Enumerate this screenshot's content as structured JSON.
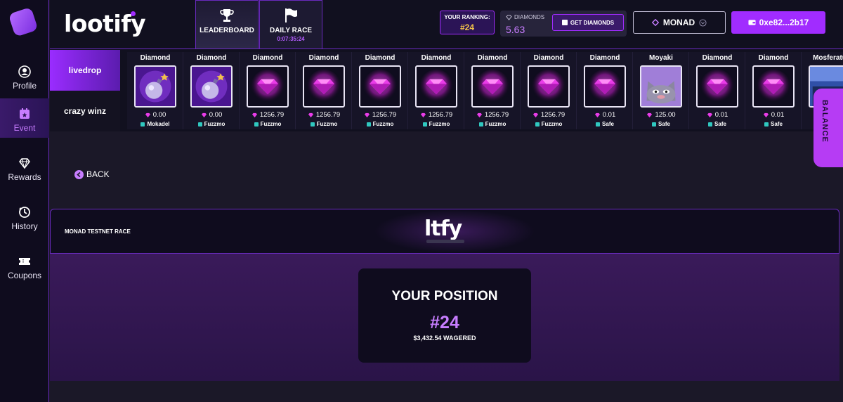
{
  "brand": {
    "name": "lootify"
  },
  "sidebar": {
    "items": [
      {
        "label": "Profile",
        "icon": "profile-icon"
      },
      {
        "label": "Event",
        "icon": "event-icon"
      },
      {
        "label": "Rewards",
        "icon": "diamond-icon"
      },
      {
        "label": "History",
        "icon": "history-icon"
      },
      {
        "label": "Coupons",
        "icon": "coupon-icon"
      }
    ],
    "active": "Event"
  },
  "header": {
    "leaderboard_label": "LEADERBOARD",
    "daily_race_label": "DAILY RACE",
    "daily_race_timer": "0:07:35:24",
    "ranking_label": "YOUR RANKING:",
    "ranking_value": "#24",
    "diamonds_label": "DIAMONDS",
    "diamonds_value": "5.63",
    "get_diamonds_label": "GET DIAMONDS",
    "network_label": "MONAD",
    "wallet_label": "0xe82...2b17"
  },
  "livedrop": {
    "tabs": [
      "livedrop",
      "crazy winz"
    ],
    "items": [
      {
        "name": "Diamond",
        "value": "0.00",
        "user": "Mokadel",
        "art": "bomb"
      },
      {
        "name": "Diamond",
        "value": "0.00",
        "user": "Fuzzmo",
        "art": "bomb"
      },
      {
        "name": "Diamond",
        "value": "1256.79",
        "user": "Fuzzmo",
        "art": "gem"
      },
      {
        "name": "Diamond",
        "value": "1256.79",
        "user": "Fuzzmo",
        "art": "gem"
      },
      {
        "name": "Diamond",
        "value": "1256.79",
        "user": "Fuzzmo",
        "art": "gem"
      },
      {
        "name": "Diamond",
        "value": "1256.79",
        "user": "Fuzzmo",
        "art": "gem"
      },
      {
        "name": "Diamond",
        "value": "1256.79",
        "user": "Fuzzmo",
        "art": "gem"
      },
      {
        "name": "Diamond",
        "value": "1256.79",
        "user": "Fuzzmo",
        "art": "gem"
      },
      {
        "name": "Diamond",
        "value": "0.01",
        "user": "Safe",
        "art": "gem"
      },
      {
        "name": "Moyaki",
        "value": "125.00",
        "user": "Safe",
        "art": "cat"
      },
      {
        "name": "Diamond",
        "value": "0.01",
        "user": "Safe",
        "art": "gem"
      },
      {
        "name": "Diamond",
        "value": "0.01",
        "user": "Safe",
        "art": "gem"
      },
      {
        "name": "Mosferatu",
        "value": "",
        "user": "",
        "art": "mosf"
      }
    ]
  },
  "balance_label": "BALANCE",
  "back_label": "BACK",
  "race": {
    "title": "MONAD TESTNET RACE",
    "logo_text": "ltfy"
  },
  "position": {
    "heading": "YOUR POSITION",
    "rank": "#24",
    "wagered": "$3,432.54 WAGERED"
  },
  "colors": {
    "accent": "#a12cff",
    "accent_light": "#c77dff",
    "gold": "#f2c24a",
    "bg": "#1b1828"
  }
}
